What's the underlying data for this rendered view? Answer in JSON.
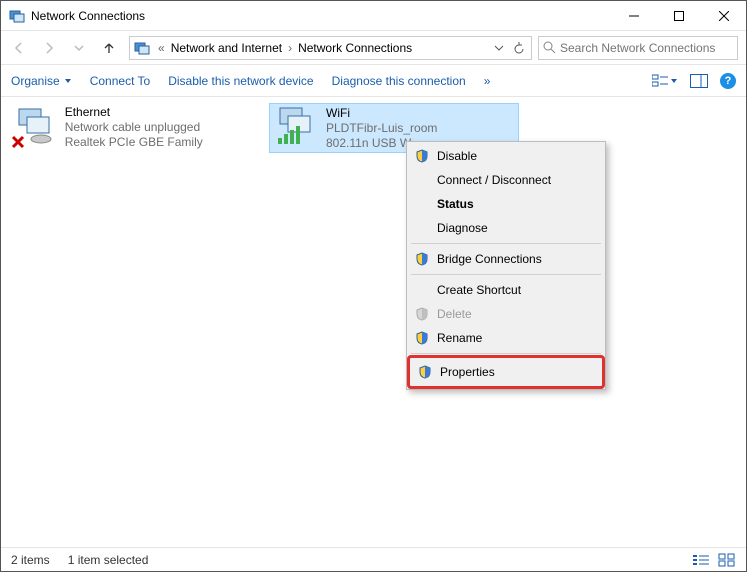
{
  "window": {
    "title": "Network Connections"
  },
  "nav": {
    "breadcrumb": [
      "Network and Internet",
      "Network Connections"
    ],
    "refresh_tooltip": "Refresh"
  },
  "search": {
    "placeholder": "Search Network Connections"
  },
  "toolbar": {
    "organise": "Organise",
    "connect_to": "Connect To",
    "disable": "Disable this network device",
    "diagnose": "Diagnose this connection",
    "overflow": "»"
  },
  "connections": [
    {
      "name": "Ethernet",
      "status": "Network cable unplugged",
      "adapter": "Realtek PCIe GBE Family Controller",
      "selected": false,
      "icon": "ethernet"
    },
    {
      "name": "WiFi",
      "status": "PLDTFibr-Luis_room",
      "adapter": "802.11n USB W",
      "selected": true,
      "icon": "wifi"
    }
  ],
  "context_menu": {
    "items": [
      {
        "label": "Disable",
        "shield": true
      },
      {
        "label": "Connect / Disconnect"
      },
      {
        "label": "Status",
        "bold": true
      },
      {
        "label": "Diagnose"
      },
      {
        "sep": true
      },
      {
        "label": "Bridge Connections",
        "shield": true
      },
      {
        "sep": true
      },
      {
        "label": "Create Shortcut"
      },
      {
        "label": "Delete",
        "shield": true,
        "disabled": true
      },
      {
        "label": "Rename",
        "shield": true
      },
      {
        "sep": true
      },
      {
        "label": "Properties",
        "shield": true,
        "highlighted": true
      }
    ]
  },
  "statusbar": {
    "count": "2 items",
    "selection": "1 item selected"
  }
}
